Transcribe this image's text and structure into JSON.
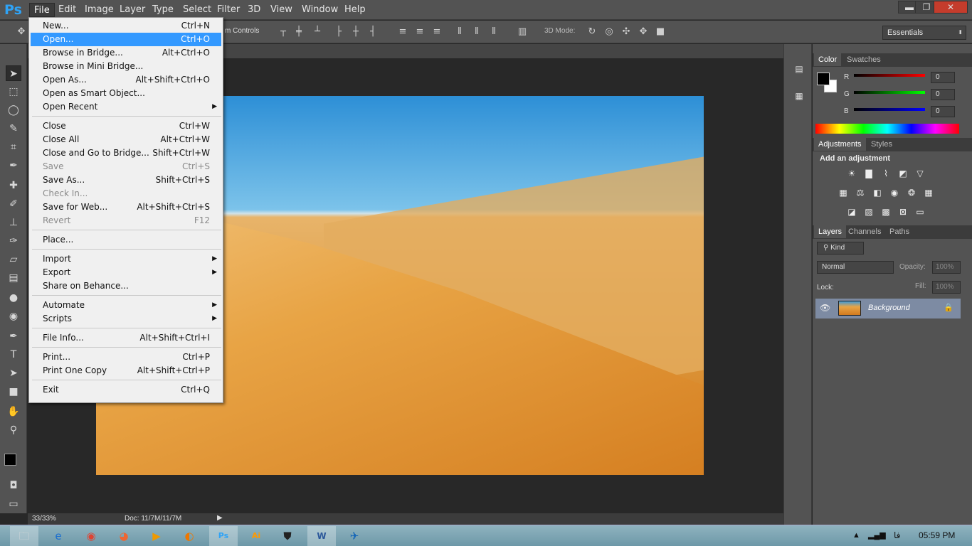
{
  "app": {
    "logo": "Ps"
  },
  "menubar": [
    "File",
    "Edit",
    "Image",
    "Layer",
    "Type",
    "Select",
    "Filter",
    "3D",
    "View",
    "Window",
    "Help"
  ],
  "window": {
    "min": "▬",
    "restore": "❐",
    "close": "✕"
  },
  "options": {
    "controls_label": "m Controls",
    "mode3d": "3D Mode:",
    "workspace": "Essentials"
  },
  "file_menu": [
    {
      "label": "New...",
      "shortcut": "Ctrl+N"
    },
    {
      "label": "Open...",
      "shortcut": "Ctrl+O",
      "highlighted": true
    },
    {
      "label": "Browse in Bridge...",
      "shortcut": "Alt+Ctrl+O"
    },
    {
      "label": "Browse in Mini Bridge...",
      "shortcut": ""
    },
    {
      "label": "Open As...",
      "shortcut": "Alt+Shift+Ctrl+O"
    },
    {
      "label": "Open as Smart Object...",
      "shortcut": ""
    },
    {
      "label": "Open Recent",
      "shortcut": "",
      "submenu": true
    },
    {
      "sep": true
    },
    {
      "label": "Close",
      "shortcut": "Ctrl+W"
    },
    {
      "label": "Close All",
      "shortcut": "Alt+Ctrl+W"
    },
    {
      "label": "Close and Go to Bridge...",
      "shortcut": "Shift+Ctrl+W"
    },
    {
      "label": "Save",
      "shortcut": "Ctrl+S",
      "disabled": true
    },
    {
      "label": "Save As...",
      "shortcut": "Shift+Ctrl+S"
    },
    {
      "label": "Check In...",
      "shortcut": "",
      "disabled": true
    },
    {
      "label": "Save for Web...",
      "shortcut": "Alt+Shift+Ctrl+S"
    },
    {
      "label": "Revert",
      "shortcut": "F12",
      "disabled": true
    },
    {
      "sep": true
    },
    {
      "label": "Place...",
      "shortcut": ""
    },
    {
      "sep": true
    },
    {
      "label": "Import",
      "shortcut": "",
      "submenu": true
    },
    {
      "label": "Export",
      "shortcut": "",
      "submenu": true
    },
    {
      "label": "Share on Behance...",
      "shortcut": ""
    },
    {
      "sep": true
    },
    {
      "label": "Automate",
      "shortcut": "",
      "submenu": true
    },
    {
      "label": "Scripts",
      "shortcut": "",
      "submenu": true
    },
    {
      "sep": true
    },
    {
      "label": "File Info...",
      "shortcut": "Alt+Shift+Ctrl+I"
    },
    {
      "sep": true
    },
    {
      "label": "Print...",
      "shortcut": "Ctrl+P"
    },
    {
      "label": "Print One Copy",
      "shortcut": "Alt+Shift+Ctrl+P"
    },
    {
      "sep": true
    },
    {
      "label": "Exit",
      "shortcut": "Ctrl+Q"
    }
  ],
  "status": {
    "zoom": "33/33%",
    "doc": "Doc: 11/7M/11/7M"
  },
  "color_panel": {
    "tabs": [
      "Color",
      "Swatches"
    ],
    "r_label": "R",
    "g_label": "G",
    "b_label": "B",
    "r": "0",
    "g": "0",
    "b": "0"
  },
  "adjustments": {
    "tabs": [
      "Adjustments",
      "Styles"
    ],
    "title": "Add an adjustment"
  },
  "layers": {
    "tabs": [
      "Layers",
      "Channels",
      "Paths"
    ],
    "kind": "Kind",
    "blend": "Normal",
    "opacity_label": "Opacity:",
    "opacity": "100%",
    "lock_label": "Lock:",
    "fill_label": "Fill:",
    "fill": "100%",
    "layer_name": "Background"
  },
  "taskbar": {
    "time": "05:59 PM",
    "lang": "فا"
  }
}
